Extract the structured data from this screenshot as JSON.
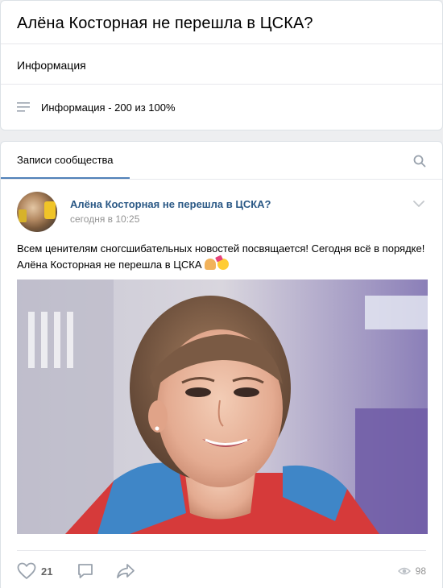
{
  "group": {
    "title": "Алёна Косторная не перешла в ЦСКА?",
    "info_section_label": "Информация",
    "info_line": "Информация - 200 из 100%"
  },
  "feed": {
    "tab_label": "Записи сообщества"
  },
  "post": {
    "author": "Алёна Косторная не перешла в ЦСКА?",
    "time": "сегодня в 10:25",
    "text": "Всем ценителям сногсшибательных новостей посвящается! Сегодня всё в порядке! Алёна Косторная не перешла в ЦСКА",
    "emojis": [
      "folded-hands",
      "partying-face"
    ],
    "likes": "21",
    "views": "98"
  },
  "colors": {
    "link": "#2a5885",
    "tab_underline": "#5181b8",
    "muted": "#939393",
    "background": "#edeef0"
  },
  "icons": [
    "lines-icon",
    "search-icon",
    "chevron-down-icon",
    "heart-icon",
    "comment-icon",
    "share-icon",
    "eye-icon"
  ]
}
